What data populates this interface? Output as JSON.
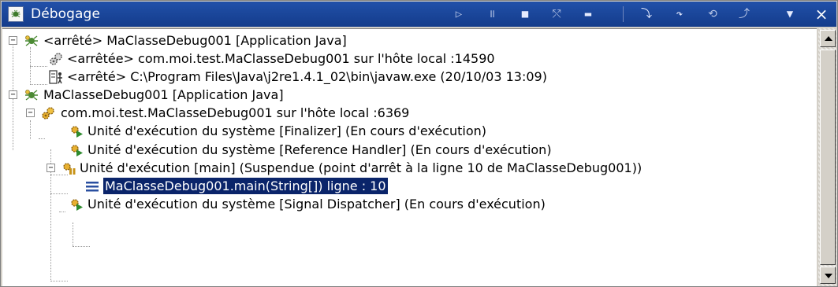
{
  "window": {
    "title": "Débogage",
    "accent": "#143c8b",
    "toolbar": [
      {
        "name": "resume-icon",
        "glyph": "▷"
      },
      {
        "name": "suspend-icon",
        "glyph": "॥"
      },
      {
        "name": "terminate-icon",
        "glyph": "■"
      },
      {
        "name": "disconnect-icon",
        "glyph": "⤲"
      },
      {
        "name": "remove-terminated-icon",
        "glyph": "▬"
      },
      {
        "name": "step-into-icon",
        "glyph": "⤵"
      },
      {
        "name": "step-over-icon",
        "glyph": "↷"
      },
      {
        "name": "step-return-icon",
        "glyph": "⟲"
      },
      {
        "name": "run-to-return-icon",
        "glyph": "⤴"
      },
      {
        "name": "view-menu-icon",
        "glyph": "▼"
      }
    ],
    "close_glyph": "×"
  },
  "tree": {
    "rows": [
      {
        "label": "<arrêté> MaClasseDebug001 [Application Java]",
        "icon": "launch-bug-icon",
        "expander": "−"
      },
      {
        "label": "<arrêtée> com.moi.test.MaClasseDebug001 sur l'hôte local :14590",
        "icon": "debug-target-icon"
      },
      {
        "label": "<arrêté> C:\\Program Files\\Java\\j2re1.4.1_02\\bin\\javaw.exe (20/10/03 13:09)",
        "icon": "process-icon"
      },
      {
        "label": "MaClasseDebug001 [Application Java]",
        "icon": "launch-bug-icon",
        "expander": "−"
      },
      {
        "label": "com.moi.test.MaClasseDebug001 sur l'hôte local :6369",
        "icon": "debug-target-icon",
        "expander": "−"
      },
      {
        "label": "Unité d'exécution du système [Finalizer] (En cours d'exécution)",
        "icon": "thread-running-icon"
      },
      {
        "label": "Unité d'exécution du système [Reference Handler] (En cours d'exécution)",
        "icon": "thread-running-icon"
      },
      {
        "label": "Unité d'exécution [main] (Suspendue (point d'arrêt à la ligne 10 de MaClasseDebug001))",
        "icon": "thread-suspended-icon",
        "expander": "−"
      },
      {
        "label": "MaClasseDebug001.main(String[]) ligne : 10",
        "icon": "stack-frame-icon",
        "selected": true
      },
      {
        "label": "Unité d'exécution du système [Signal Dispatcher] (En cours d'exécution)",
        "icon": "thread-running-icon"
      }
    ]
  },
  "colors": {
    "selection": "#0a246a",
    "thread_green": "#2e8b2e",
    "gear": "#b58a1e"
  }
}
